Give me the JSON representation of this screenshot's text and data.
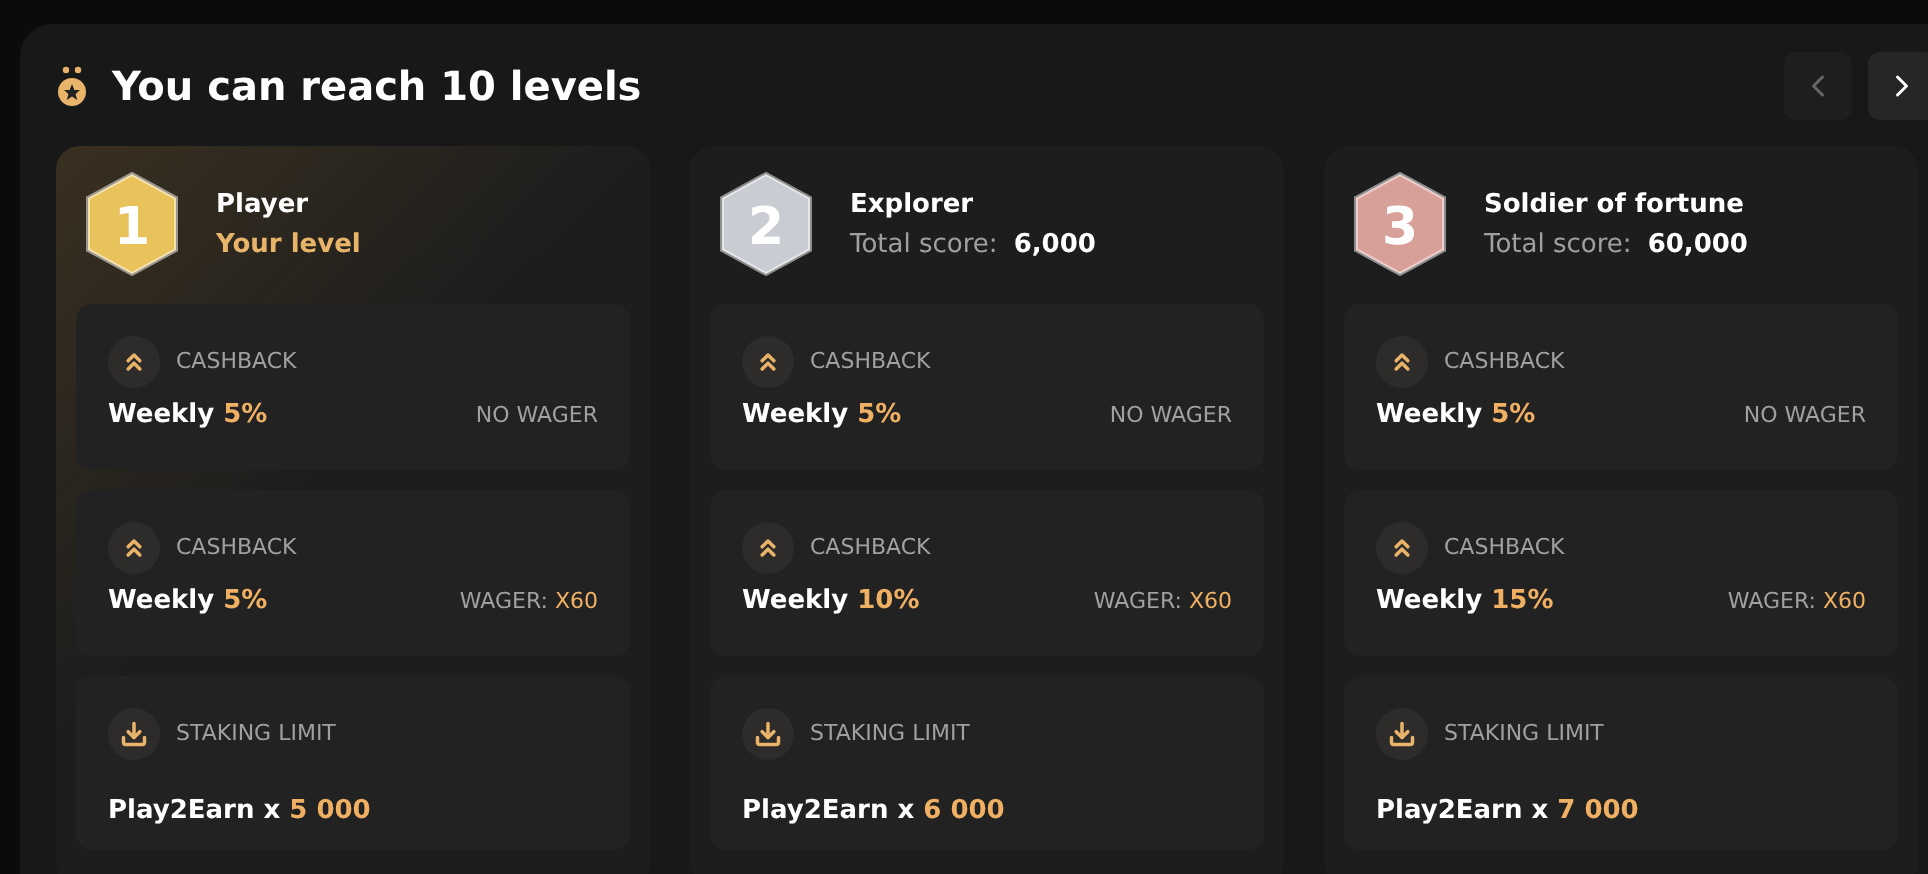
{
  "title": "You can reach 10 levels",
  "levels": [
    {
      "badge": "1",
      "color": "#e8c25a",
      "name": "Player",
      "selected": true,
      "kind": "current",
      "subtitle": "Your level",
      "perks": [
        {
          "kind": "cashback",
          "label": "CASHBACK",
          "text": "Weekly",
          "value": "5%",
          "condition": "NO WAGER"
        },
        {
          "kind": "cashback",
          "label": "CASHBACK",
          "text": "Weekly",
          "value": "5%",
          "condition": "WAGER:",
          "condition_value": "X60"
        },
        {
          "kind": "staking",
          "label": "STAKING LIMIT",
          "text": "Play2Earn x",
          "value": "5 000"
        }
      ]
    },
    {
      "badge": "2",
      "color": "#c9ccd2",
      "name": "Explorer",
      "selected": false,
      "kind": "score",
      "subtitle": "Total score:",
      "score": "6,000",
      "perks": [
        {
          "kind": "cashback",
          "label": "CASHBACK",
          "text": "Weekly",
          "value": "5%",
          "condition": "NO WAGER"
        },
        {
          "kind": "cashback",
          "label": "CASHBACK",
          "text": "Weekly",
          "value": "10%",
          "condition": "WAGER:",
          "condition_value": "X60"
        },
        {
          "kind": "staking",
          "label": "STAKING LIMIT",
          "text": "Play2Earn x",
          "value": "6 000"
        }
      ]
    },
    {
      "badge": "3",
      "color": "#d7a19a",
      "name": "Soldier of fortune",
      "selected": false,
      "kind": "score",
      "subtitle": "Total score:",
      "score": "60,000",
      "perks": [
        {
          "kind": "cashback",
          "label": "CASHBACK",
          "text": "Weekly",
          "value": "5%",
          "condition": "NO WAGER"
        },
        {
          "kind": "cashback",
          "label": "CASHBACK",
          "text": "Weekly",
          "value": "15%",
          "condition": "WAGER:",
          "condition_value": "X60"
        },
        {
          "kind": "staking",
          "label": "STAKING LIMIT",
          "text": "Play2Earn x",
          "value": "7 000"
        }
      ]
    }
  ]
}
